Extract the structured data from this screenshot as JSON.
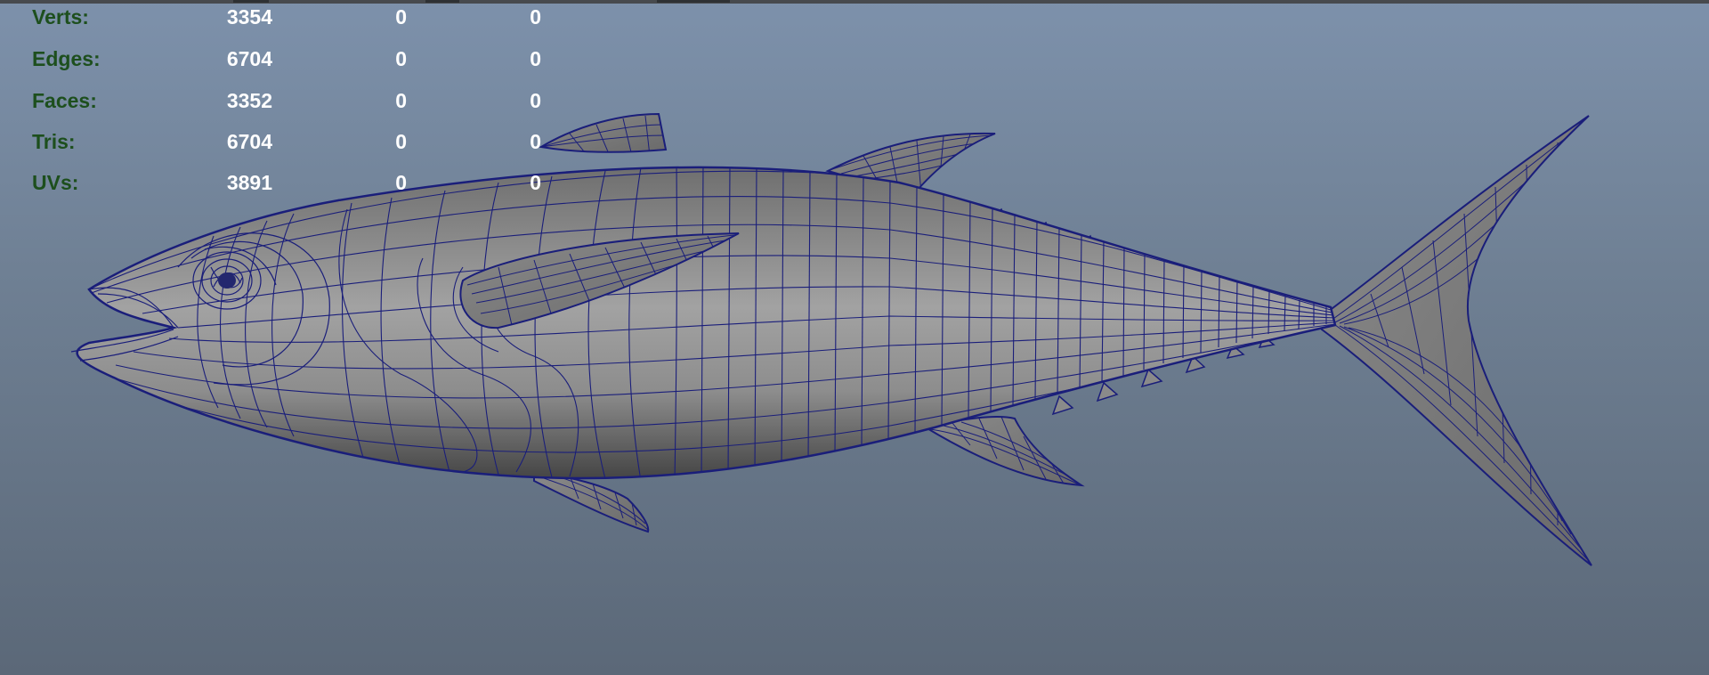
{
  "hud": {
    "rows": [
      {
        "label": "Verts:",
        "values": [
          "3354",
          "0",
          "0"
        ]
      },
      {
        "label": "Edges:",
        "values": [
          "6704",
          "0",
          "0"
        ]
      },
      {
        "label": "Faces:",
        "values": [
          "3352",
          "0",
          "0"
        ]
      },
      {
        "label": "Tris:",
        "values": [
          "6704",
          "0",
          "0"
        ]
      },
      {
        "label": "UVs:",
        "values": [
          "3891",
          "0",
          "0"
        ]
      }
    ]
  },
  "colors": {
    "background_top": "#7d91ab",
    "background_bottom": "#5b6878",
    "hud_label": "#1d4f1d",
    "hud_value": "#ffffff",
    "wireframe": "#1a1e7a",
    "surface": "#9c9c9c"
  },
  "model": {
    "icon": "tuna-fish-wireframe-mesh"
  }
}
